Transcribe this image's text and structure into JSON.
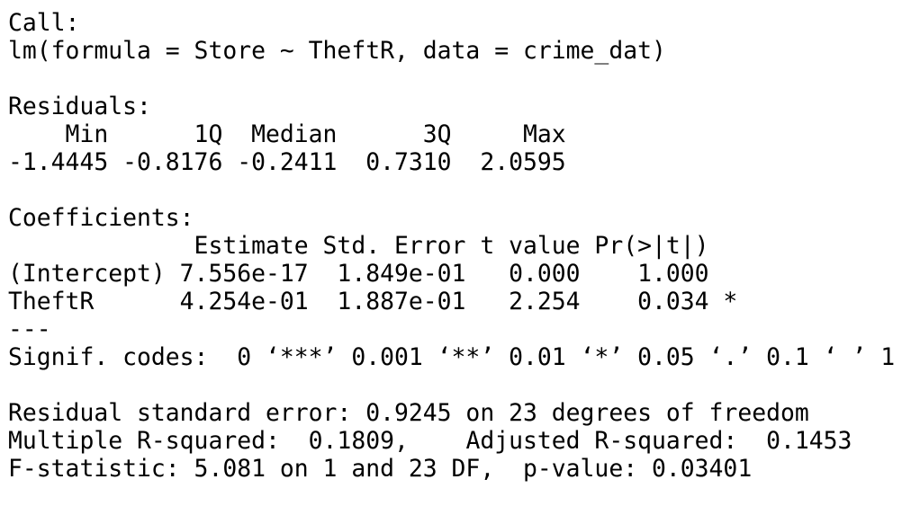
{
  "call": {
    "label": "Call:",
    "formula": "lm(formula = Store ~ TheftR, data = crime_dat)"
  },
  "residuals": {
    "label": "Residuals:",
    "header": "    Min      1Q  Median      3Q     Max ",
    "values": "-1.4445 -0.8176 -0.2411  0.7310  2.0595 "
  },
  "coefficients": {
    "label": "Coefficients:",
    "header": "             Estimate Std. Error t value Pr(>|t|)  ",
    "rows": [
      "(Intercept) 7.556e-17  1.849e-01   0.000    1.000  ",
      "TheftR      4.254e-01  1.887e-01   2.254    0.034 *"
    ],
    "separator": "---",
    "signif_codes": "Signif. codes:  0 ‘***’ 0.001 ‘**’ 0.01 ‘*’ 0.05 ‘.’ 0.1 ‘ ’ 1"
  },
  "summary": {
    "residual_se": "Residual standard error: 0.9245 on 23 degrees of freedom",
    "r_squared": "Multiple R-squared:  0.1809,\tAdjusted R-squared:  0.1453 ",
    "f_statistic": "F-statistic: 5.081 on 1 and 23 DF,  p-value: 0.03401"
  },
  "colors": {
    "text": "#000000",
    "background": "#ffffff"
  }
}
